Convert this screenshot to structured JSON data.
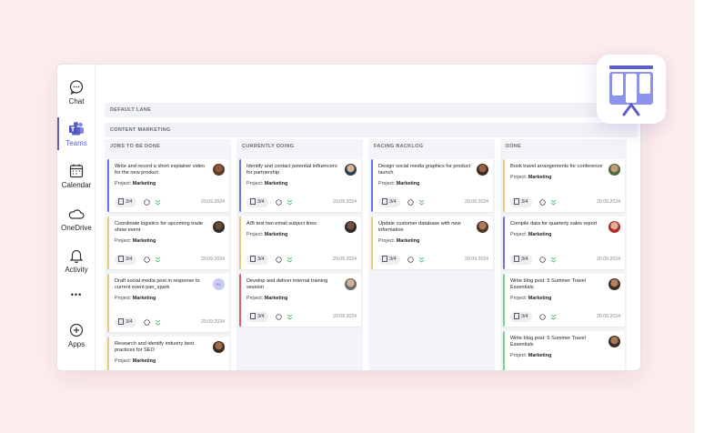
{
  "colors": {
    "accent": "#5b5fc7",
    "todo": "#f5c57a",
    "doing": "#e3a866",
    "backlog": "#b89ae0",
    "done": "#9bd3a6"
  },
  "sidebar": {
    "items": [
      {
        "label": "Chat",
        "icon": "chat-icon"
      },
      {
        "label": "Teams",
        "icon": "teams-icon",
        "active": true
      },
      {
        "label": "Calendar",
        "icon": "calendar-icon"
      },
      {
        "label": "OneDrive",
        "icon": "onedrive-icon"
      },
      {
        "label": "Activity",
        "icon": "bell-icon"
      },
      {
        "label": "•••",
        "icon": "more-icon"
      },
      {
        "label": "Apps",
        "icon": "plus-circle-icon"
      }
    ]
  },
  "board": {
    "default_lane": "DEFAULT LANE",
    "swimlane": "CONTENT MARKETING",
    "columns": [
      {
        "title": "JOBS TO BE DONE",
        "cards": [
          {
            "title": "Write and record a short explainer video for the new product",
            "project": "Marketing",
            "checklist": "3/4",
            "date": "20.09.2024"
          },
          {
            "title": "Coordinate logistics for upcoming trade show event",
            "project": "Marketing",
            "checklist": "3/4",
            "date": "20.09.2024"
          },
          {
            "title": "Draft social media post in response to current event pan_spark",
            "project": "Marketing",
            "checklist": "3/4",
            "date": "20.09.2024",
            "avatar_initials": "AL"
          },
          {
            "title": "Research and identify industry best practices for SEO",
            "project": "Marketing"
          }
        ]
      },
      {
        "title": "CURRENTLY DOING",
        "cards": [
          {
            "title": "Identify and contact potential influencers for partnership",
            "project": "Marketing",
            "checklist": "3/4",
            "date": "20.09.2024"
          },
          {
            "title": "A/B test two email subject lines",
            "project": "Marketing",
            "checklist": "3/4",
            "date": "20.09.2024"
          },
          {
            "title": "Develop and deliver internal training session",
            "project": "Marketing",
            "checklist": "3/4",
            "date": "20.09.2024"
          }
        ]
      },
      {
        "title": "FACING BACKLOG",
        "cards": [
          {
            "title": "Design social media graphics for product launch",
            "project": "Marketing",
            "checklist": "3/4",
            "date": "20.09.2024"
          },
          {
            "title": "Update customer database with new information",
            "project": "Marketing",
            "checklist": "3/4",
            "date": "20.09.2024"
          }
        ]
      },
      {
        "title": "DONE",
        "cards": [
          {
            "title": "Book travel arrangements for conference",
            "project": "Marketing",
            "checklist": "3/4",
            "date": "20.09.2024"
          },
          {
            "title": "Compile data for quarterly sales report",
            "project": "Marketing",
            "checklist": "3/4",
            "date": "20.09.2024"
          },
          {
            "title": "Write blog post: 5 Summer Travel Essentials",
            "project": "Marketing",
            "checklist": "3/4",
            "date": "20.09.2024"
          },
          {
            "title": "Write blog post: 5 Summer Travel Essentials",
            "project": "Marketing"
          }
        ]
      }
    ],
    "project_label": "Project:"
  },
  "app_icon": "kanban-board-icon"
}
